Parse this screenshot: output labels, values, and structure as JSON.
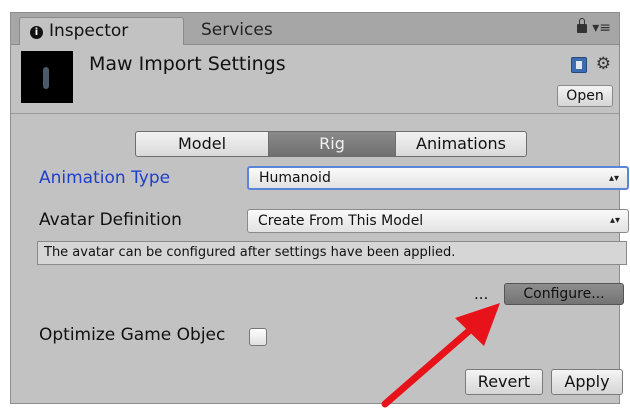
{
  "tabs": {
    "inspector": "Inspector",
    "services": "Services"
  },
  "header": {
    "title": "Maw Import Settings",
    "open_label": "Open"
  },
  "segments": {
    "model": "Model",
    "rig": "Rig",
    "animations": "Animations",
    "selected": "Rig"
  },
  "animation_type": {
    "label": "Animation Type",
    "value": "Humanoid"
  },
  "avatar_definition": {
    "label": "Avatar Definition",
    "value": "Create From This Model"
  },
  "help_text": "The avatar can be configured after settings have been applied.",
  "configure": {
    "ellipsis": "...",
    "label": "Configure..."
  },
  "optimize": {
    "label": "Optimize Game Objec",
    "checked": false
  },
  "footer": {
    "revert_label": "Revert",
    "apply_label": "Apply"
  },
  "colors": {
    "panel_bg": "#c2c2c2",
    "highlight_label": "#1e3fc8",
    "annotation_arrow": "#e8121a"
  }
}
